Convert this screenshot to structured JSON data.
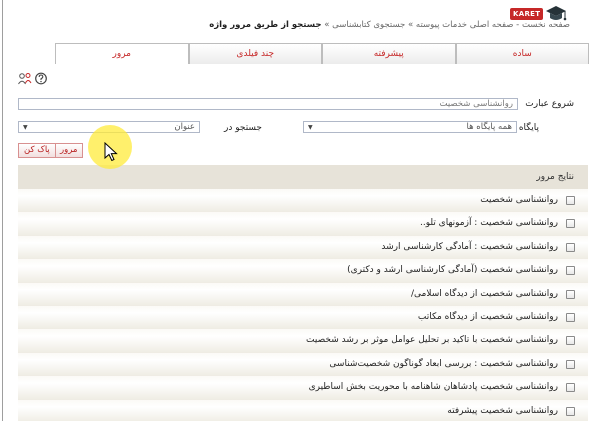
{
  "header": {
    "logo_text": "KARET",
    "breadcrumb": {
      "path": "صفحه نخست - صفحه اصلی خدمات پیوسته » جستجوی کتابشناسی »",
      "current": "جستجو از طریق مرور واژه"
    }
  },
  "tabs": [
    {
      "label": "ساده",
      "active": false
    },
    {
      "label": "پیشرفته",
      "active": false
    },
    {
      "label": "چند فیلدی",
      "active": false
    },
    {
      "label": "مرور",
      "active": true
    }
  ],
  "help_icons": [
    "help-icon",
    "people-icon"
  ],
  "form": {
    "start_label": "شروع عبارت",
    "search_value": "روانشناسی شخصیت",
    "database_label": "پایگاه",
    "database_value": "همه پایگاه ها",
    "search_in_label": "جستجو در",
    "search_in_value": "عنوان",
    "browse_button": "مرور",
    "clear_button": "پاک کن"
  },
  "results": {
    "header": "نتایج مرور",
    "items": [
      "روانشناسی شخصیت",
      "روانشناسی شخصیت : آزمونهای تلو..",
      "روانشناسی شخصیت : آمادگی کارشناسی ارشد",
      "روانشناسی شخصیت (آمادگی کارشناسی ارشد و دکتری)",
      "روانشناسی شخصیت از دیدگاه اسلامی/",
      "روانشناسی شخصیت از دیدگاه مکاتب",
      "روانشناسی شخصیت با تاکید بر تحلیل عوامل موثر بر رشد شخصیت",
      "روانشناسی شخصیت : بررسی ابعاد گوناگون شخصیت‌شناسی",
      "روانشناسی شخصیت پادشاهان شاهنامه با محوریت بخش اساطیری",
      "روانشناسی شخصیت پیشرفته"
    ]
  },
  "colors": {
    "accent": "#c62828",
    "results_header_bg": "#e7e3d9",
    "highlight": "#ffeb3b"
  }
}
